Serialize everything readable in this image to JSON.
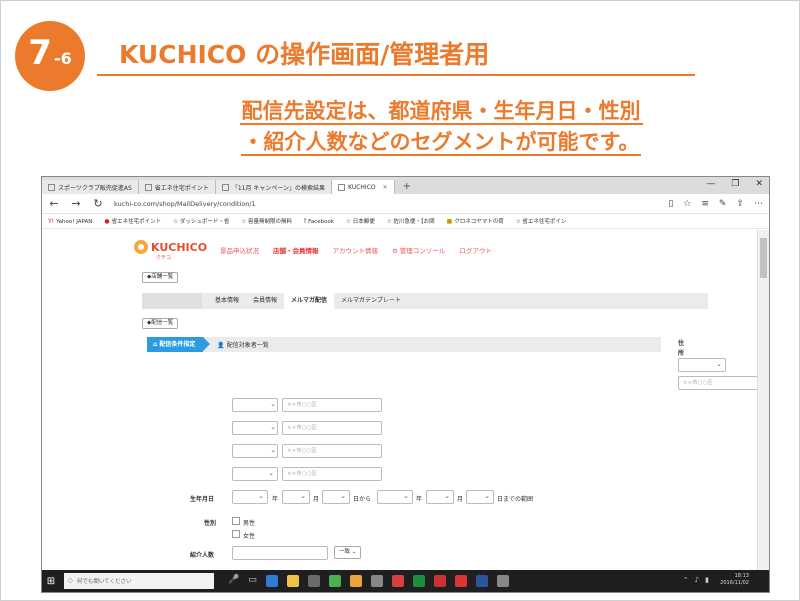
{
  "slide": {
    "badge_number": "7",
    "badge_sub": "-6",
    "title": "KUCHICO の操作画面/管理者用",
    "subtitle_line1": "配信先設定は、都道府県・生年月日・性別",
    "subtitle_line2": "・紹介人数などのセグメントが可能です。"
  },
  "browser": {
    "tabs": [
      {
        "label": "スポーツクラブ販売促進AS",
        "active": false
      },
      {
        "label": "省エネ住宅ポイント",
        "active": false
      },
      {
        "label": "「11月 キャンペーン」の検索結果",
        "active": false
      },
      {
        "label": "KUCHICO",
        "active": true
      }
    ],
    "new_tab": "+",
    "url": "kuchi-co.com/shop/MailDelivery/condition/1",
    "bookmarks": [
      "Yahoo! JAPAN",
      "省エネ住宅ポイント",
      "ダッシュボード・省",
      "容量無制限の無料",
      "Facebook",
      "日本郵便",
      "佐川急便・【お問",
      "クロネコヤマトの荷",
      "省エネ住宅ポイン"
    ]
  },
  "app": {
    "logo": "KUCHICO",
    "logo_sub": "クチコ",
    "nav": [
      {
        "label": "景品申込状況",
        "current": false
      },
      {
        "label": "店舗・会員情報",
        "current": true
      },
      {
        "label": "アカウント情報",
        "current": false
      },
      {
        "label": "⚙ 管理コンソール",
        "current": false
      },
      {
        "label": "ログアウト",
        "current": false
      }
    ],
    "back_store_list": "◆店舗一覧",
    "subtabs": [
      {
        "label": "基本情報",
        "active": false
      },
      {
        "label": "会員情報",
        "active": false
      },
      {
        "label": "メルマガ配信",
        "active": true
      },
      {
        "label": "メルマガテンプレート",
        "active": false
      }
    ],
    "back_delivery_list": "◆配信一覧",
    "steps": {
      "step1": "配信条件指定",
      "step2": "配信対象者一覧"
    },
    "side": {
      "label_line1": "住",
      "label_line2": "所",
      "placeholder": "××市○○区"
    },
    "city_placeholder": "××市○○区",
    "birth": {
      "label": "生年月日",
      "year": "年",
      "month": "月",
      "day_from": "日から",
      "day_until": "日までの範囲"
    },
    "gender": {
      "label": "性別",
      "male": "男性",
      "female": "女性"
    },
    "referrals": {
      "label": "紹介人数",
      "match": "一致"
    }
  },
  "taskbar": {
    "search_placeholder": "何でも聞いてください",
    "time": "18:13",
    "date": "2016/11/02"
  },
  "colors": {
    "accent": "#ec7a2c",
    "step_blue": "#2c9be0",
    "nav_red": "#e55555"
  }
}
